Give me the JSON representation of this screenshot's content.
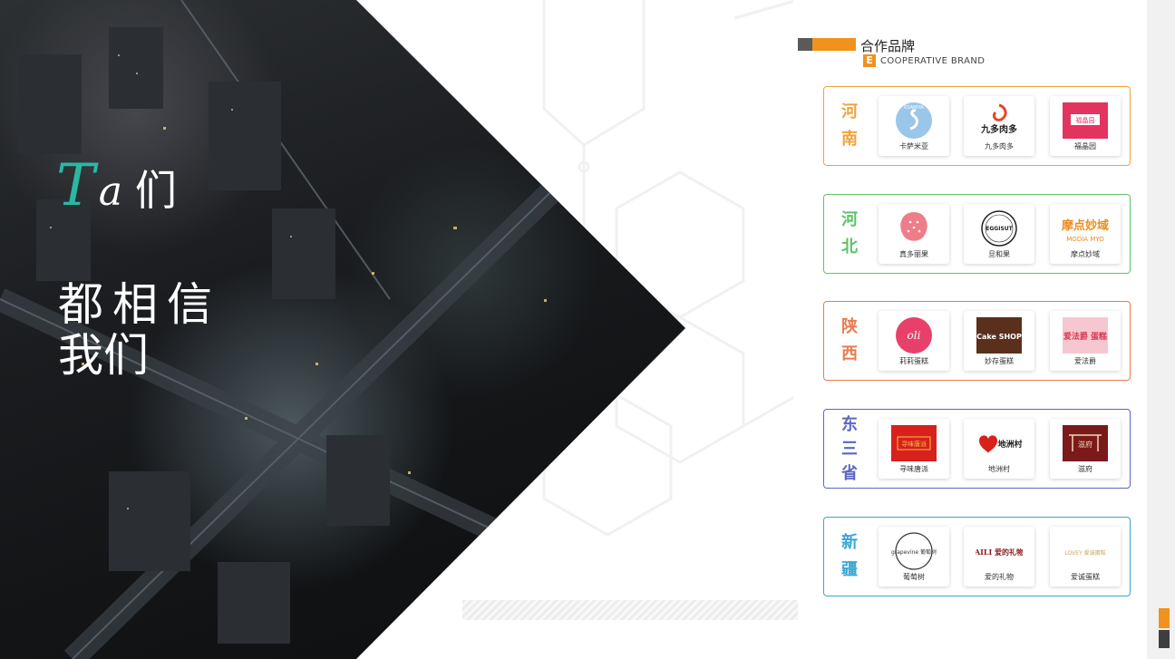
{
  "hero": {
    "ta_letter_t": "T",
    "ta_letter_a": "a",
    "ta_suffix": "们",
    "slogan_line1": "都相信",
    "slogan_line2": "我们",
    "accent_color": "#29b9a3"
  },
  "section": {
    "title": "合作品牌",
    "badge_letter": "E",
    "subtitle": "COOPERATIVE BRAND",
    "accent_color": "#f0921e"
  },
  "regions": [
    {
      "name": "河南",
      "color": "#f0a33c",
      "brands": [
        {
          "name": "卡萨米亚",
          "logo_text": "KSAMIYA",
          "icon": "swan-logo-icon"
        },
        {
          "name": "九多肉多",
          "logo_text": "九多肉多",
          "icon": "jiuduo-logo-icon"
        },
        {
          "name": "福晶园",
          "logo_text": "福晶园",
          "icon": "fujingyuan-logo-icon"
        }
      ]
    },
    {
      "name": "河北",
      "color": "#5fc26a",
      "brands": [
        {
          "name": "真多丽果",
          "logo_text": "",
          "icon": "strawberry-logo-icon"
        },
        {
          "name": "旦和果",
          "logo_text": "EGGISUT",
          "icon": "eggisut-logo-icon"
        },
        {
          "name": "摩点妙域",
          "logo_text": "MODIA MYO",
          "icon": "modia-logo-icon"
        }
      ]
    },
    {
      "name": "陕西",
      "color": "#ec7a4e",
      "brands": [
        {
          "name": "莉莉蛋糕",
          "logo_text": "oli",
          "icon": "lili-logo-icon"
        },
        {
          "name": "妙存蛋糕",
          "logo_text": "Cake SHOP",
          "icon": "cakeshop-logo-icon"
        },
        {
          "name": "爱法爵",
          "logo_text": "爱法爵 蛋糕",
          "icon": "aifajue-logo-icon"
        }
      ]
    },
    {
      "name": "东三省",
      "color": "#5b66c4",
      "brands": [
        {
          "name": "寻味唐派",
          "logo_text": "寻味唐派",
          "icon": "tangpai-logo-icon"
        },
        {
          "name": "地洲村",
          "logo_text": "地洲村",
          "icon": "dizhoucun-logo-icon"
        },
        {
          "name": "滋府",
          "logo_text": "滋府",
          "icon": "zifu-logo-icon"
        }
      ]
    },
    {
      "name": "新疆",
      "color": "#3aa6d6",
      "brands": [
        {
          "name": "葡萄树",
          "logo_text": "grapevine 葡萄树",
          "icon": "grapevine-logo-icon"
        },
        {
          "name": "爱的礼物",
          "logo_text": "AILI 爱的礼物",
          "icon": "aili-logo-icon"
        },
        {
          "name": "爱诚蛋糕",
          "logo_text": "LOVEY 爱诚蛋糕",
          "icon": "lovey-logo-icon"
        }
      ]
    }
  ]
}
